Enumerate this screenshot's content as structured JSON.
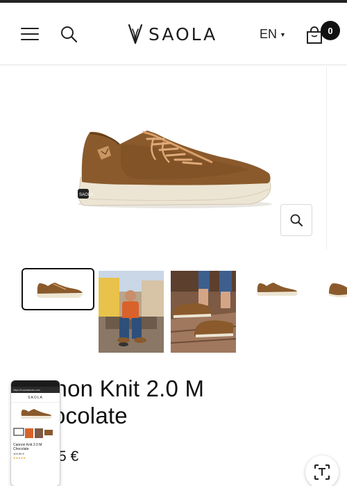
{
  "header": {
    "brand": "SAOLA",
    "language": "EN",
    "cart_count": "0"
  },
  "product": {
    "title_line1": "nnon Knit 2.0 M",
    "title_line2": "ocolate",
    "price_visible": "5 €",
    "color": "#8a5a2c"
  },
  "overlay_screenshot": {
    "url": "https://fr.saolashoes.com",
    "brand": "SAOLA",
    "title": "Cannon Knit 2.0 M Chocolate",
    "price": "109,95 €",
    "stars": "★★★★★"
  },
  "icons": {
    "menu": "hamburger-icon",
    "search": "search-icon",
    "cart": "cart-icon",
    "zoom": "zoom-icon",
    "scan": "text-scan-icon"
  },
  "colors": {
    "text": "#111111",
    "shoe_brown": "#8a5a2c",
    "laces": "#d9a06b",
    "sole": "#ede5d3"
  }
}
